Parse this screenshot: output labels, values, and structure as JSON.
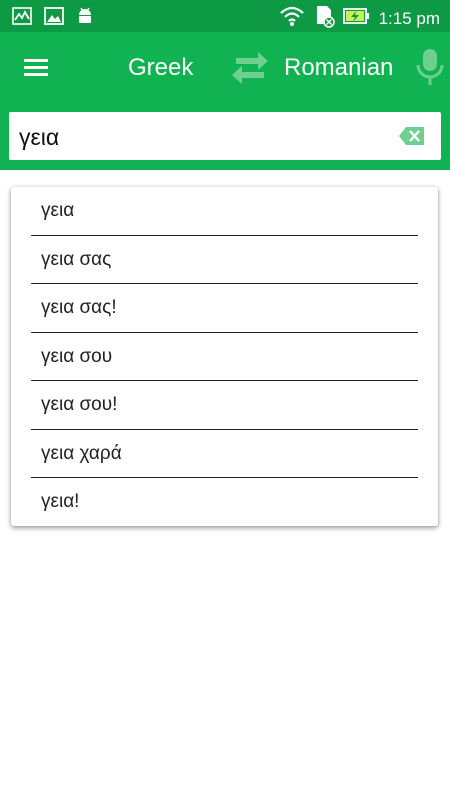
{
  "status_bar": {
    "time": "1:15 pm",
    "left_icons": [
      "activity-icon",
      "image-icon",
      "android-icon"
    ],
    "right_icons": [
      "wifi-icon",
      "sd-card-icon",
      "battery-charging-icon"
    ]
  },
  "toolbar": {
    "menu_icon": "menu-icon",
    "source_language": "Greek",
    "swap_icon": "swap-icon",
    "target_language": "Romanian",
    "mic_icon": "mic-icon"
  },
  "search": {
    "value": "γεια",
    "clear_icon": "backspace-icon"
  },
  "suggestions": [
    {
      "text": "γεια"
    },
    {
      "text": "γεια σας"
    },
    {
      "text": "γεια σας!"
    },
    {
      "text": "γεια σου"
    },
    {
      "text": "γεια σου!"
    },
    {
      "text": "γεια χαρά"
    },
    {
      "text": "γεια!"
    }
  ],
  "colors": {
    "status_bar": "#0e9a45",
    "app_bar": "#10b251",
    "accent_icon": "#6fcf8f"
  }
}
